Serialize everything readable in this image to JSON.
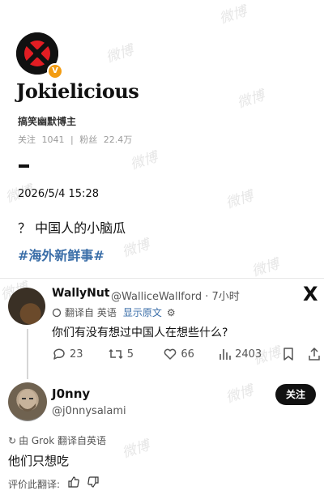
{
  "profile": {
    "username": "Jokielicious",
    "verified_badge": "V",
    "bio": "搞笑幽默博主",
    "stats": {
      "following_label": "关注",
      "following_value": "1041",
      "separator": "|",
      "followers_label": "粉丝",
      "followers_value": "22.4万"
    }
  },
  "post": {
    "time": "2026/5/4 15:28",
    "content": "？ 中国人的小脑瓜",
    "hashtag": "#海外新鲜事#"
  },
  "watermark": "微博",
  "tweet": {
    "author_name": "WallyNut",
    "author_handle": "@WalliceWallford · 7小时",
    "platform_icon": "X",
    "translation_note": "翻译自 英语",
    "show_original": "显示原文",
    "text": "你们有没有想过中国人在想些什么?",
    "actions": {
      "replies": "23",
      "retweets": "5",
      "likes": "66",
      "views": "2403"
    }
  },
  "reply": {
    "author_name": "J0nny",
    "author_handle": "@j0nnysalami",
    "follow_label": "关注",
    "grok_note": "由 Grok 翻译自英语",
    "text": "他们只想吃",
    "rate_translation": "评价此翻译:"
  },
  "colors": {
    "link": "#3a6ea8",
    "badge": "#f39c12",
    "follow_bg": "#111111"
  }
}
